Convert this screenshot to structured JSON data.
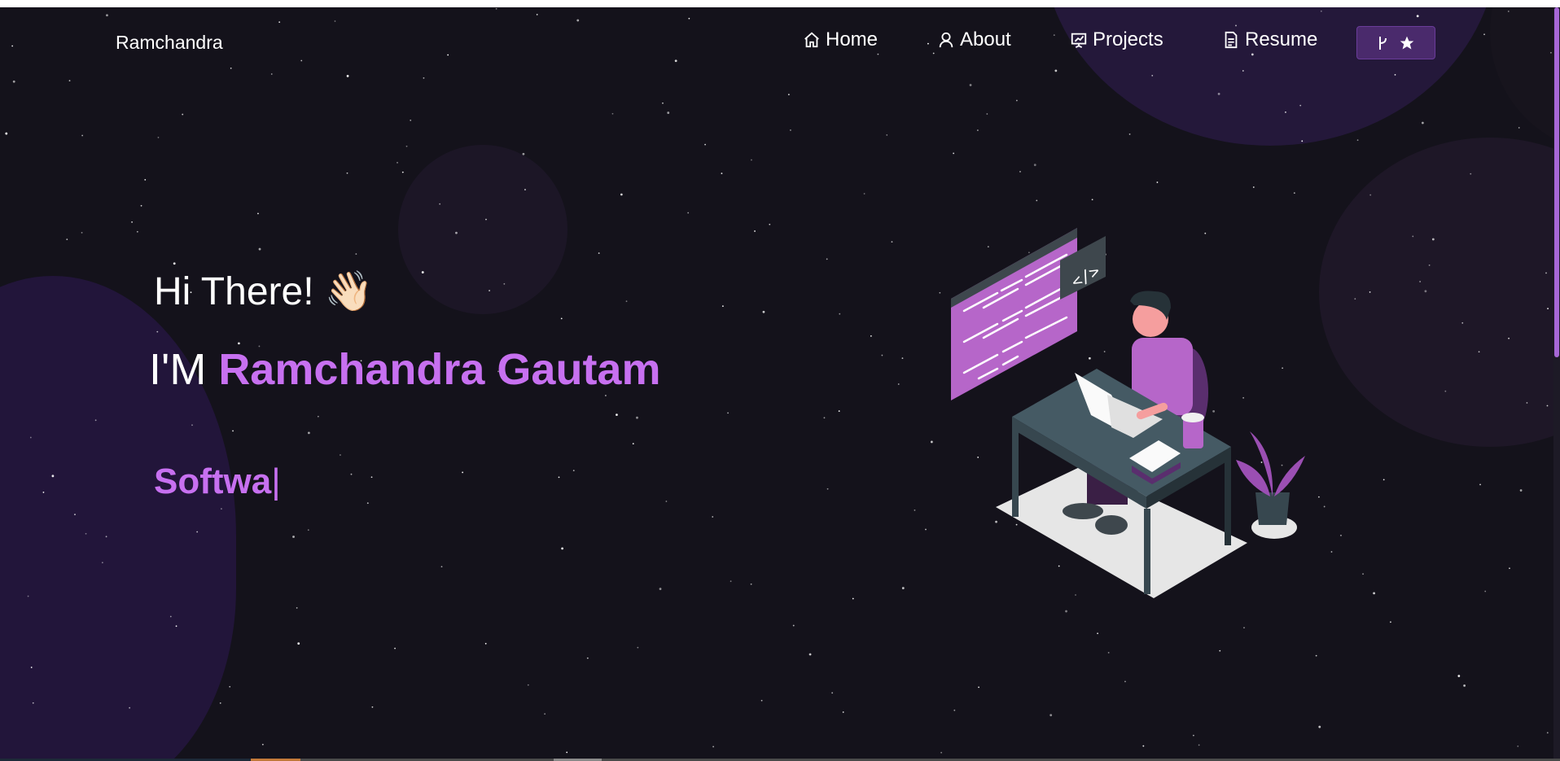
{
  "navbar": {
    "brand": "Ramchandra",
    "items": [
      {
        "label": "Home",
        "icon": "home-icon"
      },
      {
        "label": "About",
        "icon": "user-icon"
      },
      {
        "label": "Projects",
        "icon": "project-diagram-icon"
      },
      {
        "label": "Resume",
        "icon": "document-icon"
      }
    ],
    "fork_button": {
      "icons": [
        "git-fork-icon",
        "star-icon"
      ]
    }
  },
  "hero": {
    "greeting": "Hi There!",
    "greeting_emoji": "👋🏻",
    "intro_prefix": "I'M",
    "name": "Ramchandra Gautam",
    "typed_text": "Softwa",
    "typed_cursor": "|"
  },
  "colors": {
    "accent": "#c770f0",
    "background": "#14121b",
    "button": "#4a2a6c"
  }
}
